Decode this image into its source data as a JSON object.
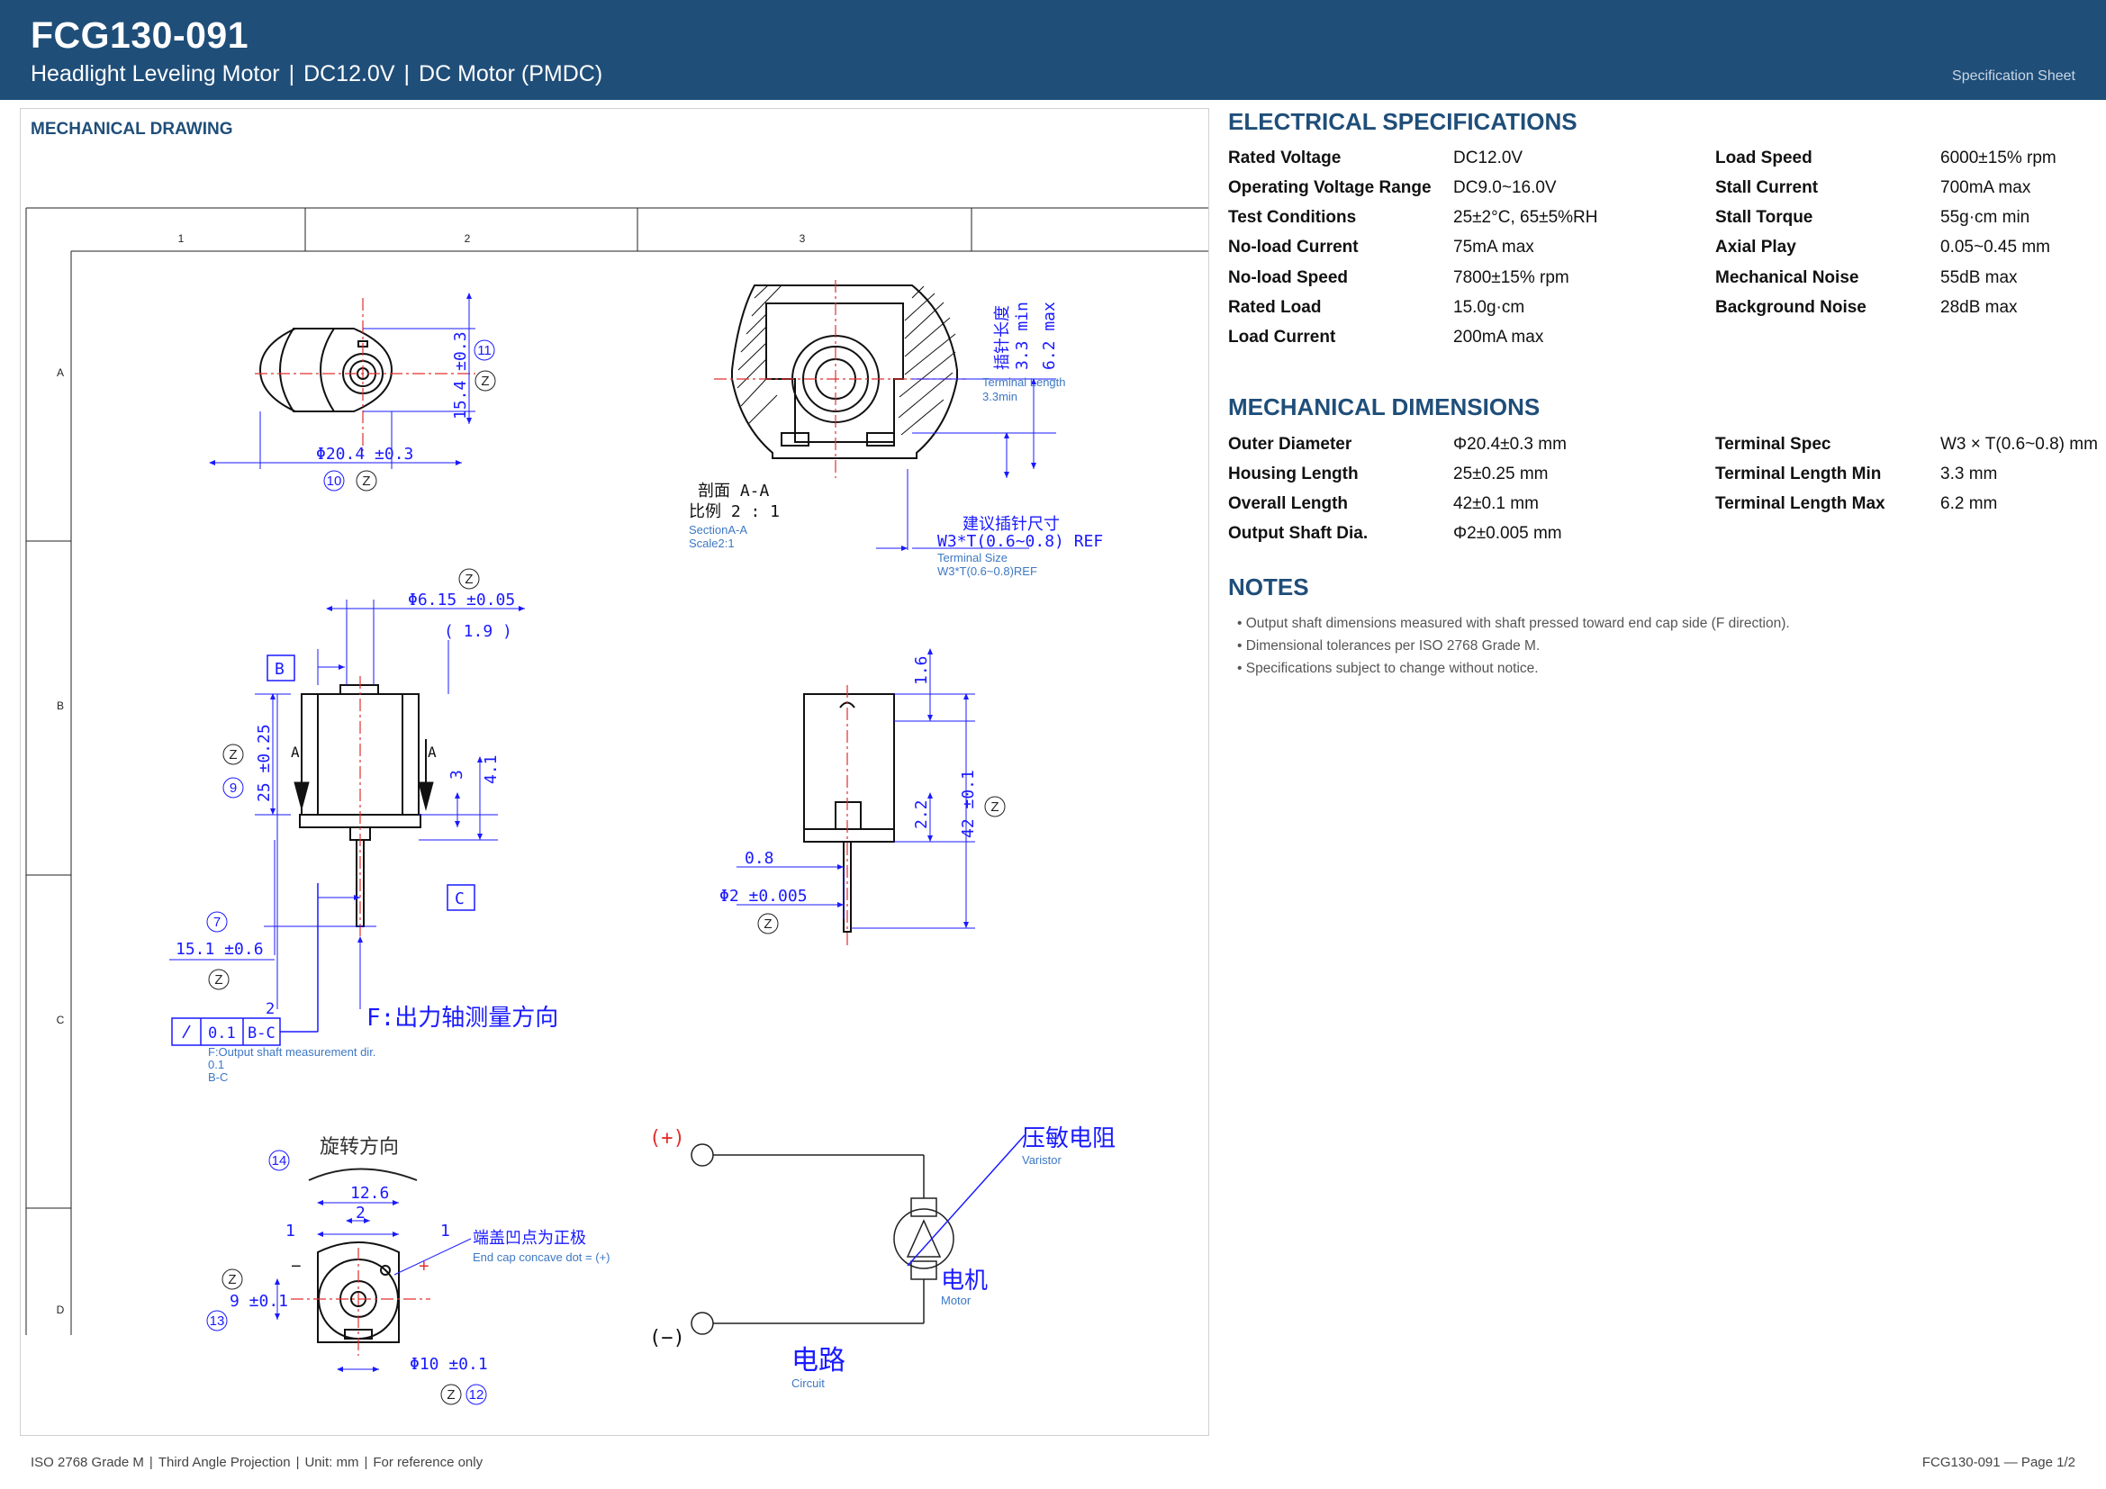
{
  "header": {
    "part_number": "FCG130-091",
    "product_type": "Headlight Leveling Motor",
    "voltage": "DC12.0V",
    "motor_type": "DC Motor (PMDC)",
    "sep": "|",
    "sheet_label": "Specification Sheet"
  },
  "drawing": {
    "title": "MECHANICAL DRAWING",
    "zone_columns": [
      "1",
      "2",
      "3"
    ],
    "zone_rows": [
      "A",
      "B",
      "C",
      "D"
    ],
    "labels": {
      "dia_20_4": "Φ20.4 ±0.3",
      "len_15_4": "15.4 ±0.3",
      "section_cn": "剖面 A-A",
      "scale_cn": "比例 2 : 1",
      "section_en": "SectionA-A",
      "scale_en": "Scale2:1",
      "term_len_cn": "插针长度",
      "term_len_min": "3.3 min",
      "term_len_max": "6.2 max",
      "term_len_en": "Terminal Length",
      "term_len_en2": "3.3min",
      "term_size_cn": "建议插针尺寸",
      "term_size": "W3*T(0.6~0.8) REF",
      "term_size_en": "Terminal Size",
      "term_size_en2": "W3*T(0.6~0.8)REF",
      "dia_6_15": "Φ6.15 ±0.05",
      "dim_1_9": "( 1.9 )",
      "datum_b": "B",
      "datum_c": "C",
      "len_25": "25 ±0.25",
      "dim_3": "3",
      "dim_4_1": "4.1",
      "dim_15_1": "15.1 ±0.6",
      "dim_1_6": "1.6",
      "dim_2_2": "2.2",
      "dim_42": "42 ±0.1",
      "dim_0_8": "0.8",
      "dia_2": "Φ2 ±0.005",
      "f_dir_cn": "F:出力轴测量方向",
      "f_dir_en": "F:Output shaft measurement dir.",
      "runout_val": "0.1",
      "runout_ref": "B-C",
      "runout_2": "2",
      "runout_en1": "0.1",
      "runout_en2": "B-C",
      "rot_cn": "旋转方向",
      "dim_12_6": "12.6",
      "dim_1": "1",
      "dim_2": "2",
      "dim_9": "9 ±0.1",
      "dia_10": "Φ10 ±0.1",
      "endcap_cn": "端盖凹点为正极",
      "endcap_en": "End cap concave dot = (+)",
      "plus": "(+)",
      "minus": "(−)",
      "varistor_cn": "压敏电阻",
      "varistor_en": "Varistor",
      "motor_cn": "电机",
      "motor_en": "Motor",
      "circuit_cn": "电路",
      "circuit_en": "Circuit",
      "balloon_z": "Z",
      "b9": "9",
      "b7": "7",
      "b10": "10",
      "b11": "11",
      "b12": "12",
      "b13": "13",
      "b14": "14",
      "arrow_a": "A",
      "minus_sign": "−",
      "plus_sign": "+"
    }
  },
  "electrical": {
    "title": "ELECTRICAL SPECIFICATIONS",
    "left": [
      {
        "label": "Rated Voltage",
        "value": "DC12.0V"
      },
      {
        "label": "Operating Voltage Range",
        "value": "DC9.0~16.0V"
      },
      {
        "label": "Test Conditions",
        "value": "25±2°C, 65±5%RH"
      },
      {
        "label": "No-load Current",
        "value": "75mA max"
      },
      {
        "label": "No-load Speed",
        "value": "7800±15% rpm"
      },
      {
        "label": "Rated Load",
        "value": "15.0g·cm"
      },
      {
        "label": "Load Current",
        "value": "200mA max"
      }
    ],
    "right": [
      {
        "label": "Load Speed",
        "value": "6000±15% rpm"
      },
      {
        "label": "Stall Current",
        "value": "700mA max"
      },
      {
        "label": "Stall Torque",
        "value": "55g·cm min"
      },
      {
        "label": "Axial Play",
        "value": "0.05~0.45 mm"
      },
      {
        "label": "Mechanical Noise",
        "value": "55dB max"
      },
      {
        "label": "Background Noise",
        "value": "28dB max"
      }
    ]
  },
  "mechanical": {
    "title": "MECHANICAL DIMENSIONS",
    "left": [
      {
        "label": "Outer Diameter",
        "value": "Φ20.4±0.3 mm"
      },
      {
        "label": "Housing Length",
        "value": "25±0.25 mm"
      },
      {
        "label": "Overall Length",
        "value": "42±0.1 mm"
      },
      {
        "label": "Output Shaft Dia.",
        "value": "Φ2±0.005 mm"
      }
    ],
    "right": [
      {
        "label": "Terminal Spec",
        "value": "W3 × T(0.6~0.8) mm"
      },
      {
        "label": "Terminal Length Min",
        "value": "3.3 mm"
      },
      {
        "label": "Terminal Length Max",
        "value": "6.2 mm"
      }
    ]
  },
  "notes": {
    "title": "NOTES",
    "items": [
      "• Output shaft dimensions measured with shaft pressed toward end cap side (F direction).",
      "• Dimensional tolerances per ISO 2768 Grade M.",
      "• Specifications subject to change without notice."
    ]
  },
  "footer": {
    "standard": "ISO 2768 Grade M",
    "projection": "Third Angle Projection",
    "unit": "Unit: mm",
    "ref": "For reference only",
    "sep": "|",
    "page": "FCG130-091  —  Page 1/2"
  }
}
